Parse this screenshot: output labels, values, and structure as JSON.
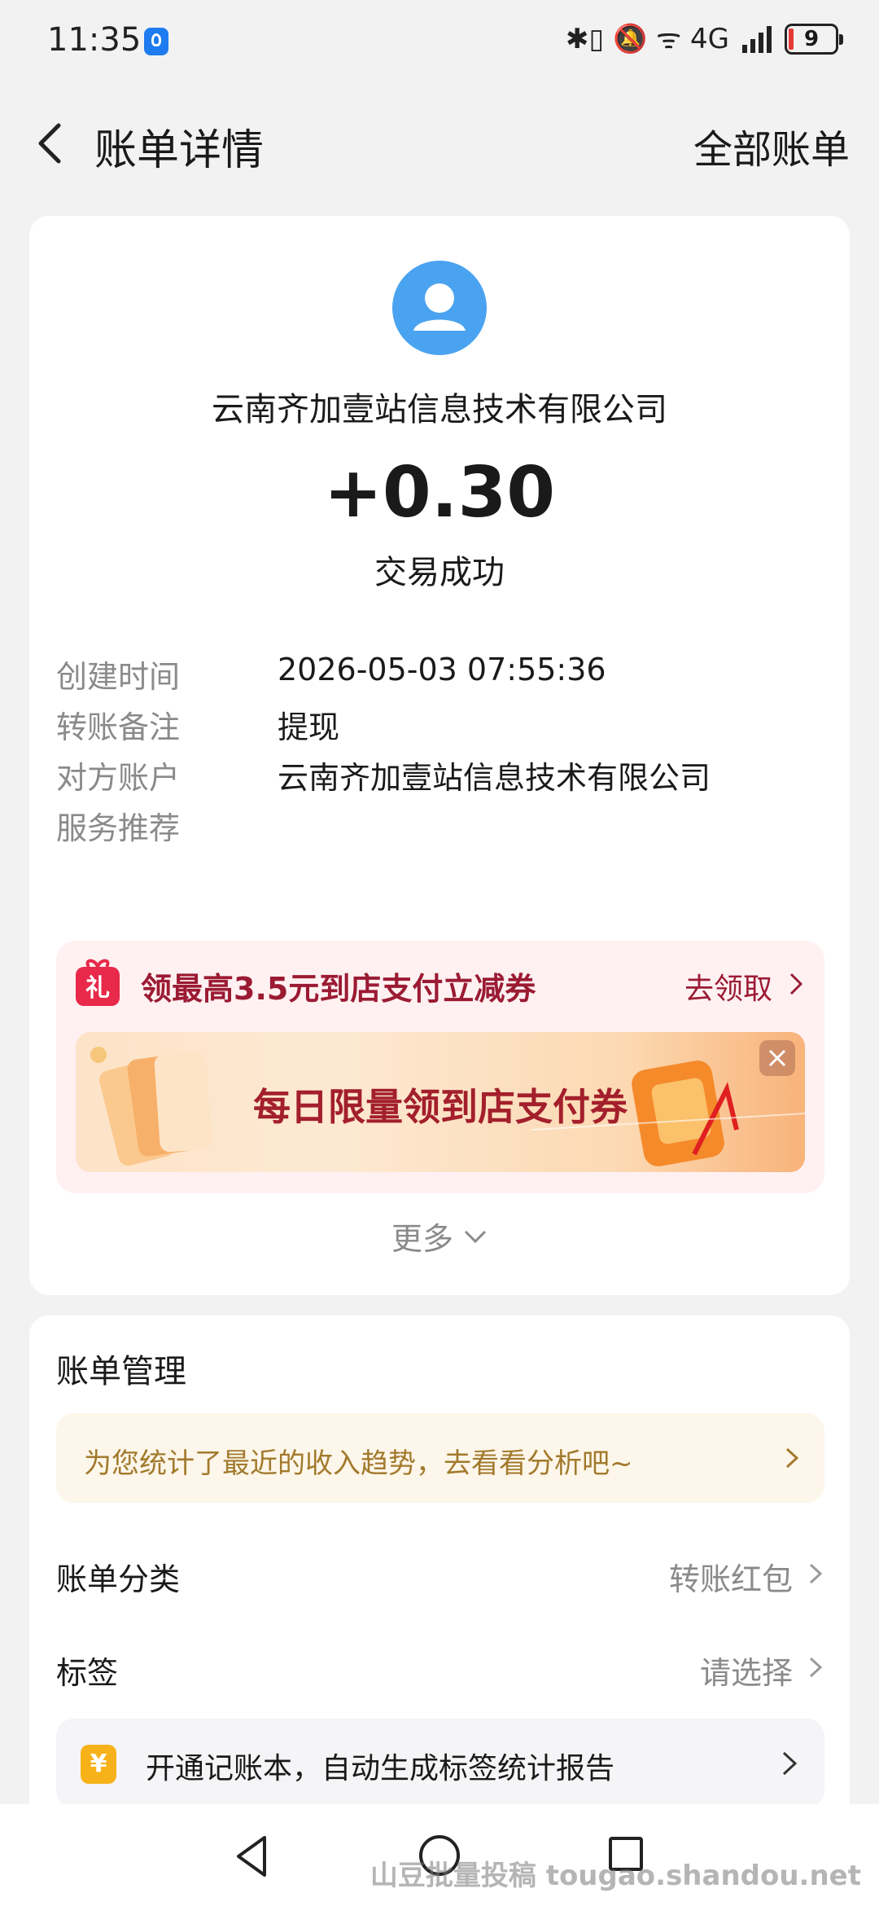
{
  "status_bar": {
    "time": "11:35",
    "icons_text": "✱▯ 🔕 ᯤ 4G",
    "battery": "9"
  },
  "header": {
    "title": "账单详情",
    "right_link": "全部账单"
  },
  "summary": {
    "merchant": "云南齐加壹站信息技术有限公司",
    "amount": "+0.30",
    "status": "交易成功"
  },
  "details": [
    {
      "label": "创建时间",
      "value": "2026-05-03 07:55:36"
    },
    {
      "label": "转账备注",
      "value": "提现"
    },
    {
      "label": "对方账户",
      "value": "云南齐加壹站信息技术有限公司"
    },
    {
      "label": "服务推荐",
      "value": ""
    }
  ],
  "promo": {
    "icon_text": "礼",
    "title": "领最高3.5元到店支付立减券",
    "link": "去领取",
    "banner_text": "每日限量领到店支付券"
  },
  "more_label": "更多",
  "bill_management": {
    "title": "账单管理",
    "tip": "为您统计了最近的收入趋势，去看看分析吧~",
    "category_label": "账单分类",
    "category_value": "转账红包",
    "tag_label": "标签",
    "tag_value": "请选择",
    "ledger_icon": "¥",
    "ledger_text": "开通记账本，自动生成标签统计报告"
  },
  "watermark": "山豆批量投稿 tougao.shandou.net",
  "colors": {
    "accent_blue": "#4aa3f0",
    "promo_red": "#9b1b33",
    "tip_gold": "#a27a2c"
  }
}
